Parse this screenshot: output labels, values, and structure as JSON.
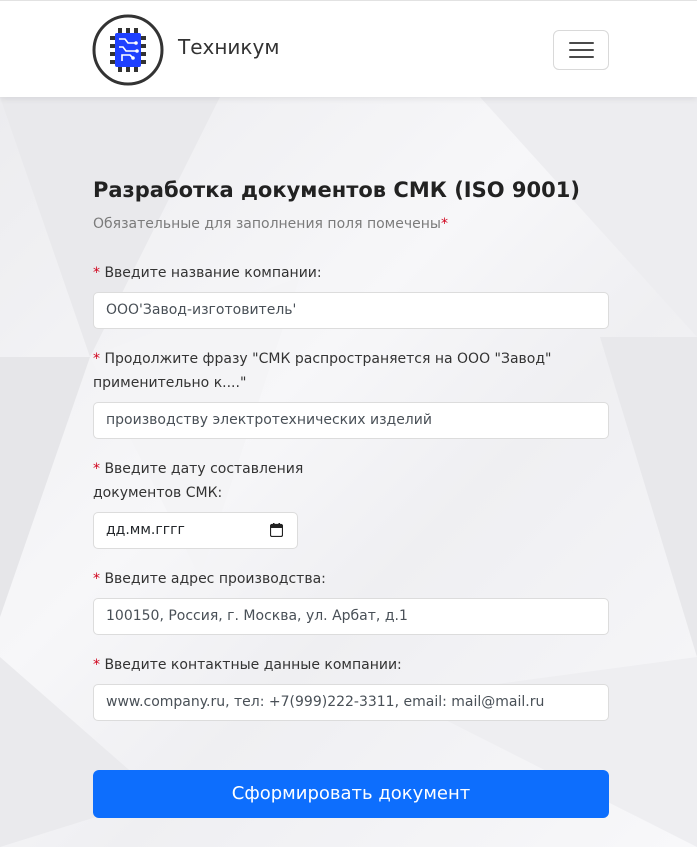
{
  "header": {
    "brand": "Техникум",
    "logo_icon": "chip-logo-icon",
    "menu_icon": "hamburger-menu-icon"
  },
  "form": {
    "title": "Разработка документов СМК (ISO 9001)",
    "subtitle": "Обязательные для заполнения поля помечены",
    "required_mark": "*",
    "fields": [
      {
        "label": "Введите название компании:",
        "placeholder": "ООО'Завод-изготовитель'"
      },
      {
        "label_line1": "Продолжите фразу \"СМК распространяется на ООО \"Завод\"",
        "label_line2": "применительно к....\"",
        "placeholder": "производству электротехнических изделий"
      },
      {
        "label_line1": "Введите дату составления",
        "label_line2": "документов СМК:",
        "placeholder": "дд.мм.гггг",
        "icon": "calendar-icon"
      },
      {
        "label": "Введите адрес производства:",
        "placeholder": "100150, Россия, г. Москва, ул. Арбат, д.1"
      },
      {
        "label": "Введите контактные данные компании:",
        "placeholder": "www.company.ru, тел: +7(999)222-3311, email: mail@mail.ru"
      }
    ],
    "submit_label": "Сформировать документ"
  },
  "colors": {
    "accent": "#0d6efd",
    "required": "#d0021b",
    "logo_blue": "#1e40ff"
  }
}
